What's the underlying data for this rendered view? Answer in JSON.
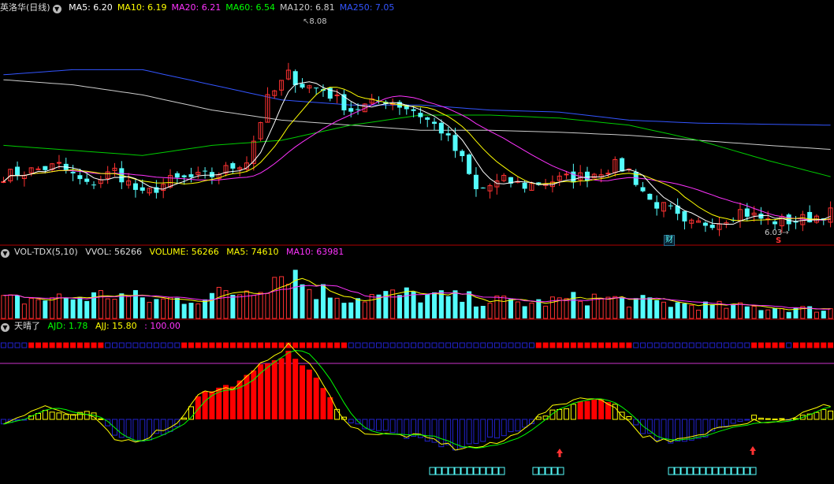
{
  "price_panel": {
    "title": "英洛华(日线)",
    "ma": [
      {
        "label": "MA5: 6.20",
        "color": "#ffffff"
      },
      {
        "label": "MA10: 6.19",
        "color": "#ffff00"
      },
      {
        "label": "MA20: 6.21",
        "color": "#ff33ff"
      },
      {
        "label": "MA60: 6.54",
        "color": "#00ff00"
      },
      {
        "label": "MA120: 6.81",
        "color": "#cccccc"
      },
      {
        "label": "MA250: 7.05",
        "color": "#3355ff"
      }
    ],
    "high_label": "8.08",
    "low_label": "6.03",
    "cai_label": "财",
    "s_label": "S"
  },
  "volume_panel": {
    "title": "VOL-TDX(5,10)",
    "vvol": "VVOL: 56266",
    "volume": "VOLUME: 56266",
    "ma5": "MA5: 74610",
    "ma10": "MA10: 63981"
  },
  "indicator_panel": {
    "title": "天晴了",
    "ajd": "AJD: 1.78",
    "ajj": "AJJ: 15.80",
    "level": ": 100.00"
  },
  "colors": {
    "up": "#ff3232",
    "down": "#54fcfc",
    "ma5": "#ffffff",
    "ma10": "#ffff00",
    "ma20": "#ff33ff",
    "ma60": "#00cc00",
    "ma120": "#cccccc",
    "ma250": "#3355ff",
    "osc_pos": "#ff0000",
    "osc_neg": "#2222cc",
    "osc_line1": "#ffff00",
    "osc_line2": "#00ff00"
  },
  "chart_data": {
    "type": "candlestick",
    "bars": 120,
    "y_range": [
      5.9,
      8.15
    ],
    "anchor_closes": [
      [
        0,
        6.55
      ],
      [
        8,
        6.65
      ],
      [
        12,
        6.45
      ],
      [
        16,
        6.6
      ],
      [
        20,
        6.35
      ],
      [
        24,
        6.5
      ],
      [
        30,
        6.55
      ],
      [
        35,
        6.7
      ],
      [
        38,
        7.3
      ],
      [
        41,
        7.55
      ],
      [
        43,
        7.45
      ],
      [
        46,
        7.4
      ],
      [
        50,
        7.2
      ],
      [
        55,
        7.3
      ],
      [
        59,
        7.2
      ],
      [
        63,
        7.0
      ],
      [
        66,
        6.7
      ],
      [
        68,
        6.4
      ],
      [
        72,
        6.5
      ],
      [
        75,
        6.45
      ],
      [
        79,
        6.5
      ],
      [
        84,
        6.55
      ],
      [
        88,
        6.65
      ],
      [
        90,
        6.6
      ],
      [
        93,
        6.3
      ],
      [
        96,
        6.2
      ],
      [
        98,
        6.05
      ],
      [
        103,
        6.1
      ],
      [
        106,
        6.2
      ],
      [
        110,
        6.1
      ],
      [
        114,
        6.1
      ],
      [
        117,
        6.15
      ],
      [
        119,
        6.18
      ]
    ],
    "volume_anchors": [
      [
        0,
        30
      ],
      [
        10,
        35
      ],
      [
        16,
        40
      ],
      [
        22,
        30
      ],
      [
        28,
        35
      ],
      [
        34,
        45
      ],
      [
        39,
        70
      ],
      [
        41,
        85
      ],
      [
        44,
        50
      ],
      [
        50,
        35
      ],
      [
        58,
        40
      ],
      [
        64,
        35
      ],
      [
        70,
        30
      ],
      [
        76,
        25
      ],
      [
        84,
        35
      ],
      [
        90,
        30
      ],
      [
        96,
        25
      ],
      [
        104,
        20
      ],
      [
        110,
        18
      ],
      [
        119,
        15
      ]
    ],
    "oscillator_anchors": [
      [
        0,
        -5
      ],
      [
        6,
        10
      ],
      [
        10,
        5
      ],
      [
        13,
        8
      ],
      [
        16,
        -20
      ],
      [
        20,
        -25
      ],
      [
        25,
        -10
      ],
      [
        28,
        30
      ],
      [
        34,
        45
      ],
      [
        38,
        70
      ],
      [
        41,
        80
      ],
      [
        44,
        60
      ],
      [
        47,
        25
      ],
      [
        50,
        -5
      ],
      [
        55,
        -15
      ],
      [
        60,
        -25
      ],
      [
        65,
        -35
      ],
      [
        72,
        -20
      ],
      [
        78,
        5
      ],
      [
        84,
        25
      ],
      [
        88,
        20
      ],
      [
        92,
        -15
      ],
      [
        96,
        -30
      ],
      [
        100,
        -25
      ],
      [
        104,
        -5
      ],
      [
        108,
        5
      ],
      [
        112,
        0
      ],
      [
        116,
        5
      ],
      [
        119,
        12
      ]
    ],
    "ma250_anchors": [
      [
        0,
        7.55
      ],
      [
        10,
        7.6
      ],
      [
        20,
        7.6
      ],
      [
        30,
        7.45
      ],
      [
        40,
        7.3
      ],
      [
        50,
        7.25
      ],
      [
        60,
        7.25
      ],
      [
        70,
        7.2
      ],
      [
        80,
        7.18
      ],
      [
        90,
        7.1
      ],
      [
        100,
        7.07
      ],
      [
        119,
        7.05
      ]
    ],
    "ma120_anchors": [
      [
        0,
        7.5
      ],
      [
        10,
        7.45
      ],
      [
        20,
        7.35
      ],
      [
        30,
        7.2
      ],
      [
        40,
        7.1
      ],
      [
        50,
        7.05
      ],
      [
        60,
        7.0
      ],
      [
        70,
        7.0
      ],
      [
        80,
        6.98
      ],
      [
        90,
        6.95
      ],
      [
        100,
        6.9
      ],
      [
        110,
        6.85
      ],
      [
        119,
        6.81
      ]
    ],
    "ma60_anchors": [
      [
        0,
        6.85
      ],
      [
        10,
        6.8
      ],
      [
        20,
        6.75
      ],
      [
        30,
        6.85
      ],
      [
        40,
        6.9
      ],
      [
        50,
        7.05
      ],
      [
        60,
        7.15
      ],
      [
        70,
        7.15
      ],
      [
        80,
        7.12
      ],
      [
        90,
        7.05
      ],
      [
        100,
        6.9
      ],
      [
        110,
        6.7
      ],
      [
        119,
        6.54
      ]
    ]
  }
}
